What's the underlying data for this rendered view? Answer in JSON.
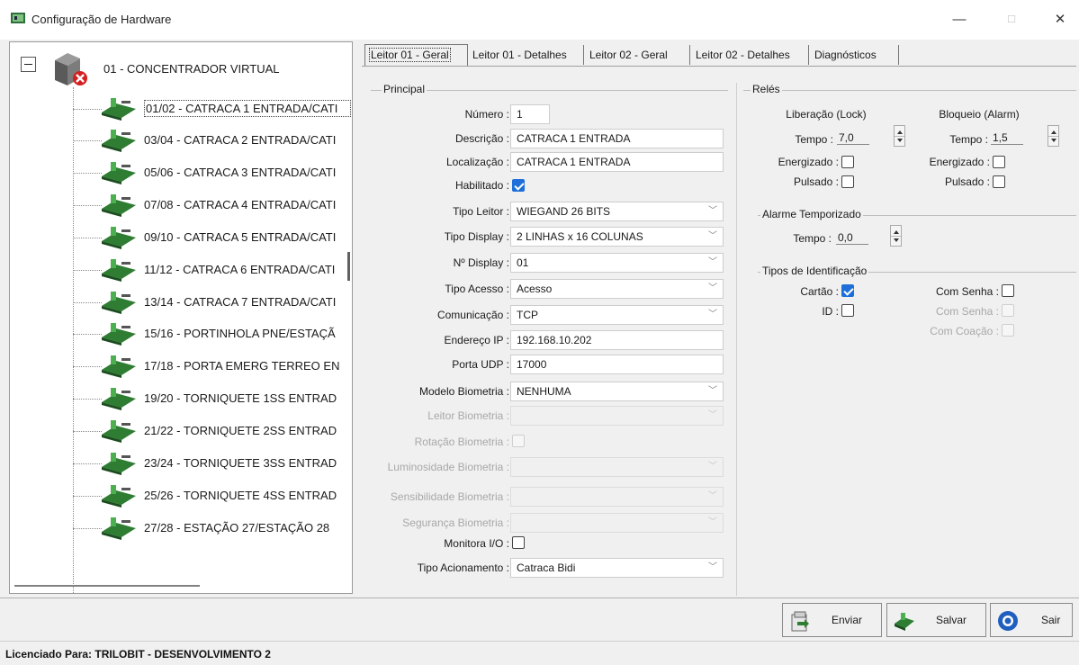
{
  "window": {
    "title": "Configuração de Hardware",
    "minimize": "—",
    "maximize": "☐",
    "close": "✕"
  },
  "tree": {
    "root_label": "01 - CONCENTRADOR VIRTUAL",
    "items": [
      {
        "label": "01/02 - CATRACA 1 ENTRADA/CATI"
      },
      {
        "label": "03/04 - CATRACA 2 ENTRADA/CATI"
      },
      {
        "label": "05/06 - CATRACA 3 ENTRADA/CATI"
      },
      {
        "label": "07/08 - CATRACA 4 ENTRADA/CATI"
      },
      {
        "label": "09/10 - CATRACA 5 ENTRADA/CATI"
      },
      {
        "label": "11/12 - CATRACA 6 ENTRADA/CATI"
      },
      {
        "label": "13/14 - CATRACA 7 ENTRADA/CATI"
      },
      {
        "label": "15/16 - PORTINHOLA PNE/ESTAÇÃ"
      },
      {
        "label": "17/18 - PORTA EMERG TERREO EN"
      },
      {
        "label": "19/20 - TORNIQUETE 1SS ENTRAD"
      },
      {
        "label": "21/22 - TORNIQUETE 2SS ENTRAD"
      },
      {
        "label": "23/24 - TORNIQUETE 3SS ENTRAD"
      },
      {
        "label": "25/26 - TORNIQUETE 4SS ENTRAD"
      },
      {
        "label": "27/28 - ESTAÇÃO 27/ESTAÇÃO 28"
      }
    ]
  },
  "tabs": [
    {
      "label": "Leitor 01 - Geral",
      "active": true
    },
    {
      "label": "Leitor 01 - Detalhes"
    },
    {
      "label": "Leitor 02 - Geral"
    },
    {
      "label": "Leitor 02 - Detalhes"
    },
    {
      "label": "Diagnósticos"
    }
  ],
  "principal": {
    "title": "Principal",
    "numero_label": "Número :",
    "numero_value": "1",
    "descricao_label": "Descrição :",
    "descricao_value": "CATRACA 1 ENTRADA",
    "localizacao_label": "Localização :",
    "localizacao_value": "CATRACA 1 ENTRADA",
    "habilitado_label": "Habilitado :",
    "habilitado_checked": true,
    "tipo_leitor_label": "Tipo Leitor :",
    "tipo_leitor_value": "WIEGAND 26 BITS",
    "tipo_display_label": "Tipo Display :",
    "tipo_display_value": "2 LINHAS x 16 COLUNAS",
    "n_display_label": "Nº Display :",
    "n_display_value": "01",
    "tipo_acesso_label": "Tipo Acesso :",
    "tipo_acesso_value": "Acesso",
    "comunicacao_label": "Comunicação :",
    "comunicacao_value": "TCP",
    "endereco_ip_label": "Endereço IP :",
    "endereco_ip_value": "192.168.10.202",
    "porta_udp_label": "Porta UDP :",
    "porta_udp_value": "17000",
    "modelo_biometria_label": "Modelo Biometria :",
    "modelo_biometria_value": "NENHUMA",
    "leitor_biometria_label": "Leitor Biometria :",
    "rotacao_biometria_label": "Rotação Biometria :",
    "luminosidade_biometria_label": "Luminosidade Biometria :",
    "sensibilidade_biometria_label": "Sensibilidade Biometria :",
    "seguranca_biometria_label": "Segurança Biometria :",
    "monitora_io_label": "Monitora I/O :",
    "tipo_acionamento_label": "Tipo Acionamento :",
    "tipo_acionamento_value": "Catraca Bidi"
  },
  "reles": {
    "title": "Relés",
    "liberacao_title": "Liberação (Lock)",
    "bloqueio_title": "Bloqueio (Alarm)",
    "tempo_label": "Tempo :",
    "liberacao_tempo": "7,0",
    "bloqueio_tempo": "1,5",
    "energizado_label": "Energizado :",
    "pulsado_label": "Pulsado :"
  },
  "alarme": {
    "title": "Alarme Temporizado",
    "tempo_label": "Tempo :",
    "tempo_value": "0,0"
  },
  "identificacao": {
    "title": "Tipos de Identificação",
    "cartao_label": "Cartão :",
    "cartao_checked": true,
    "id_label": "ID :",
    "com_senha_label": "Com Senha :",
    "com_senha_disabled_label": "Com Senha :",
    "com_coacao_label": "Com Coação :"
  },
  "buttons": {
    "enviar": "Enviar",
    "salvar": "Salvar",
    "sair": "Sair"
  },
  "status": {
    "text": "Licenciado Para: TRILOBIT - DESENVOLVIMENTO 2"
  }
}
